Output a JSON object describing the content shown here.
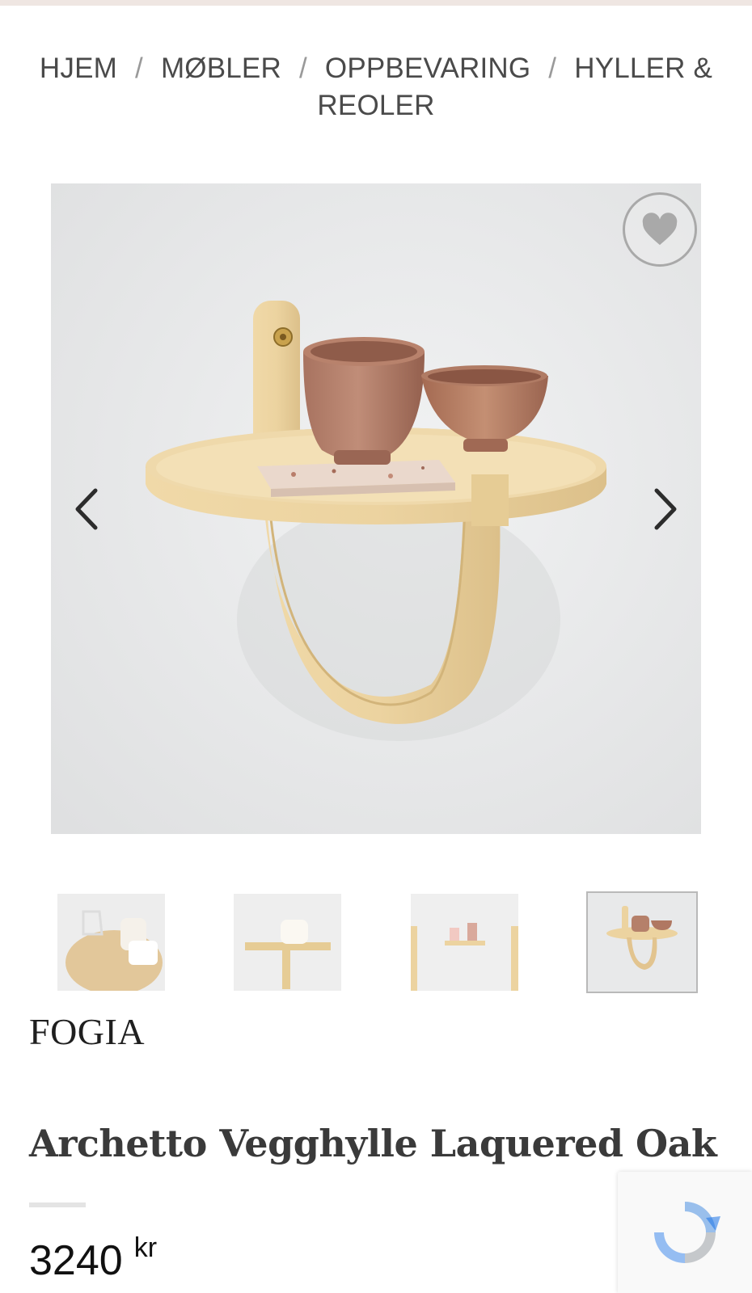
{
  "breadcrumb": {
    "items": [
      "HJEM",
      "MØBLER",
      "OPPBEVARING",
      "HYLLER & REOLER"
    ],
    "separator": "/"
  },
  "product": {
    "brand": "FOGIA",
    "title": "Archetto Vegghylle Laquered Oak",
    "price_value": "3240",
    "price_currency": "kr"
  },
  "gallery": {
    "wishlist_icon": "heart-icon",
    "prev_icon": "chevron-left-icon",
    "next_icon": "chevron-right-icon",
    "thumbnail_count": 4,
    "active_thumbnail": 4
  },
  "colors": {
    "oak": "#ecd3a0",
    "oak_dark": "#d9bb82",
    "wall": "#e9eaeb",
    "terracotta": "#b5806a",
    "text_dark": "#3a3a3a"
  }
}
